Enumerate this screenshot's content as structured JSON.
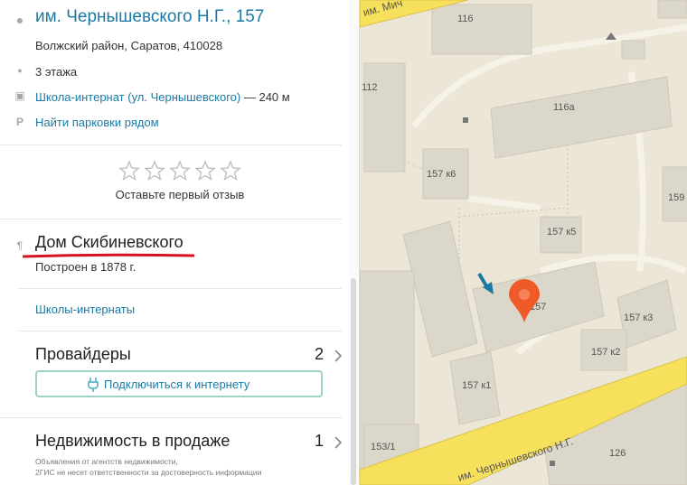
{
  "place": {
    "title": "им. Чернышевского Н.Г., 157",
    "address": "Волжский район, Саратов, 410028",
    "floors": "3 этажа",
    "transit_stop": "Школа-интернат (ул. Чернышевского)",
    "transit_distance": "— 240 м",
    "parking_link": "Найти парковки рядом"
  },
  "rating": {
    "stars": 0,
    "max_stars": 5,
    "prompt": "Оставьте первый отзыв"
  },
  "history": {
    "title": "Дом Скибиневского",
    "built": "Построен в 1878 г."
  },
  "category_link": "Школы-интернаты",
  "providers": {
    "title": "Провайдеры",
    "count": "2",
    "button_label": "Подключиться к интернету"
  },
  "realty": {
    "title": "Недвижимость в продаже",
    "count": "1",
    "disclaimer_line1": "Объявления от агентств недвижимости,",
    "disclaimer_line2": "2ГИС не несет ответственности за достоверность информации"
  },
  "map": {
    "street_top": "им. Мич",
    "street_bottom": "им. Чернышевского Н.Г.",
    "buildings": [
      "116",
      "116а",
      "112",
      "157 к6",
      "157 к5",
      "157",
      "159",
      "157 к3",
      "157 к2",
      "157 к1",
      "153/1",
      "126"
    ]
  },
  "colors": {
    "link": "#1b7aa3",
    "accent_marker": "#f05a28",
    "road": "#f7e05c",
    "underline": "#d5121f",
    "button_border": "#9fd2c7"
  }
}
